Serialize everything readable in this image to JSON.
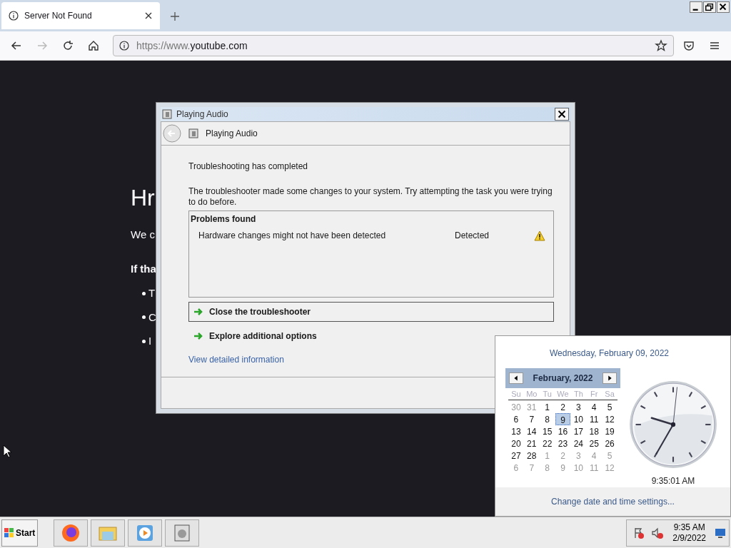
{
  "browser": {
    "tab": {
      "title": "Server Not Found"
    },
    "address": {
      "prefix": "https://www.",
      "domain": "youtube.com"
    }
  },
  "page": {
    "heading": "Hr",
    "paragraph": "We c",
    "bold_line": "If tha",
    "bullets": [
      "T",
      "C",
      "I"
    ]
  },
  "dialog": {
    "title": "Playing Audio",
    "nav_title": "Playing Audio",
    "heading": "Troubleshooting has completed",
    "message": "The troubleshooter made some changes to your system. Try attempting the task you were trying to do before.",
    "problems": {
      "header": "Problems found",
      "rows": [
        {
          "problem": "Hardware changes might not have been detected",
          "status": "Detected"
        }
      ]
    },
    "actions": [
      {
        "label": "Close the troubleshooter",
        "selected": true
      },
      {
        "label": "Explore additional options",
        "selected": false
      }
    ],
    "link": "View detailed information"
  },
  "calendar": {
    "date_line": "Wednesday, February 09, 2022",
    "month": "February, 2022",
    "weekdays": [
      "Su",
      "Mo",
      "Tu",
      "We",
      "Th",
      "Fr",
      "Sa"
    ],
    "days": [
      {
        "d": "30",
        "kind": "other",
        "selected": false
      },
      {
        "d": "31",
        "kind": "other",
        "selected": false
      },
      {
        "d": "1",
        "kind": "current",
        "selected": false
      },
      {
        "d": "2",
        "kind": "current",
        "selected": false
      },
      {
        "d": "3",
        "kind": "current",
        "selected": false
      },
      {
        "d": "4",
        "kind": "current",
        "selected": false
      },
      {
        "d": "5",
        "kind": "current",
        "selected": false
      },
      {
        "d": "6",
        "kind": "current",
        "selected": false
      },
      {
        "d": "7",
        "kind": "current",
        "selected": false
      },
      {
        "d": "8",
        "kind": "current",
        "selected": false
      },
      {
        "d": "9",
        "kind": "current",
        "selected": true
      },
      {
        "d": "10",
        "kind": "current",
        "selected": false
      },
      {
        "d": "11",
        "kind": "current",
        "selected": false
      },
      {
        "d": "12",
        "kind": "current",
        "selected": false
      },
      {
        "d": "13",
        "kind": "current",
        "selected": false
      },
      {
        "d": "14",
        "kind": "current",
        "selected": false
      },
      {
        "d": "15",
        "kind": "current",
        "selected": false
      },
      {
        "d": "16",
        "kind": "current",
        "selected": false
      },
      {
        "d": "17",
        "kind": "current",
        "selected": false
      },
      {
        "d": "18",
        "kind": "current",
        "selected": false
      },
      {
        "d": "19",
        "kind": "current",
        "selected": false
      },
      {
        "d": "20",
        "kind": "current",
        "selected": false
      },
      {
        "d": "21",
        "kind": "current",
        "selected": false
      },
      {
        "d": "22",
        "kind": "current",
        "selected": false
      },
      {
        "d": "23",
        "kind": "current",
        "selected": false
      },
      {
        "d": "24",
        "kind": "current",
        "selected": false
      },
      {
        "d": "25",
        "kind": "current",
        "selected": false
      },
      {
        "d": "26",
        "kind": "current",
        "selected": false
      },
      {
        "d": "27",
        "kind": "current",
        "selected": false
      },
      {
        "d": "28",
        "kind": "current",
        "selected": false
      },
      {
        "d": "1",
        "kind": "other",
        "selected": false
      },
      {
        "d": "2",
        "kind": "other",
        "selected": false
      },
      {
        "d": "3",
        "kind": "other",
        "selected": false
      },
      {
        "d": "4",
        "kind": "other",
        "selected": false
      },
      {
        "d": "5",
        "kind": "other",
        "selected": false
      },
      {
        "d": "6",
        "kind": "other",
        "selected": false
      },
      {
        "d": "7",
        "kind": "other",
        "selected": false
      },
      {
        "d": "8",
        "kind": "other",
        "selected": false
      },
      {
        "d": "9",
        "kind": "other",
        "selected": false
      },
      {
        "d": "10",
        "kind": "other",
        "selected": false
      },
      {
        "d": "11",
        "kind": "other",
        "selected": false
      },
      {
        "d": "12",
        "kind": "other",
        "selected": false
      }
    ],
    "time": "9:35:01 AM",
    "link": "Change date and time settings..."
  },
  "taskbar": {
    "start": "Start",
    "time": "9:35 AM",
    "date": "2/9/2022"
  }
}
